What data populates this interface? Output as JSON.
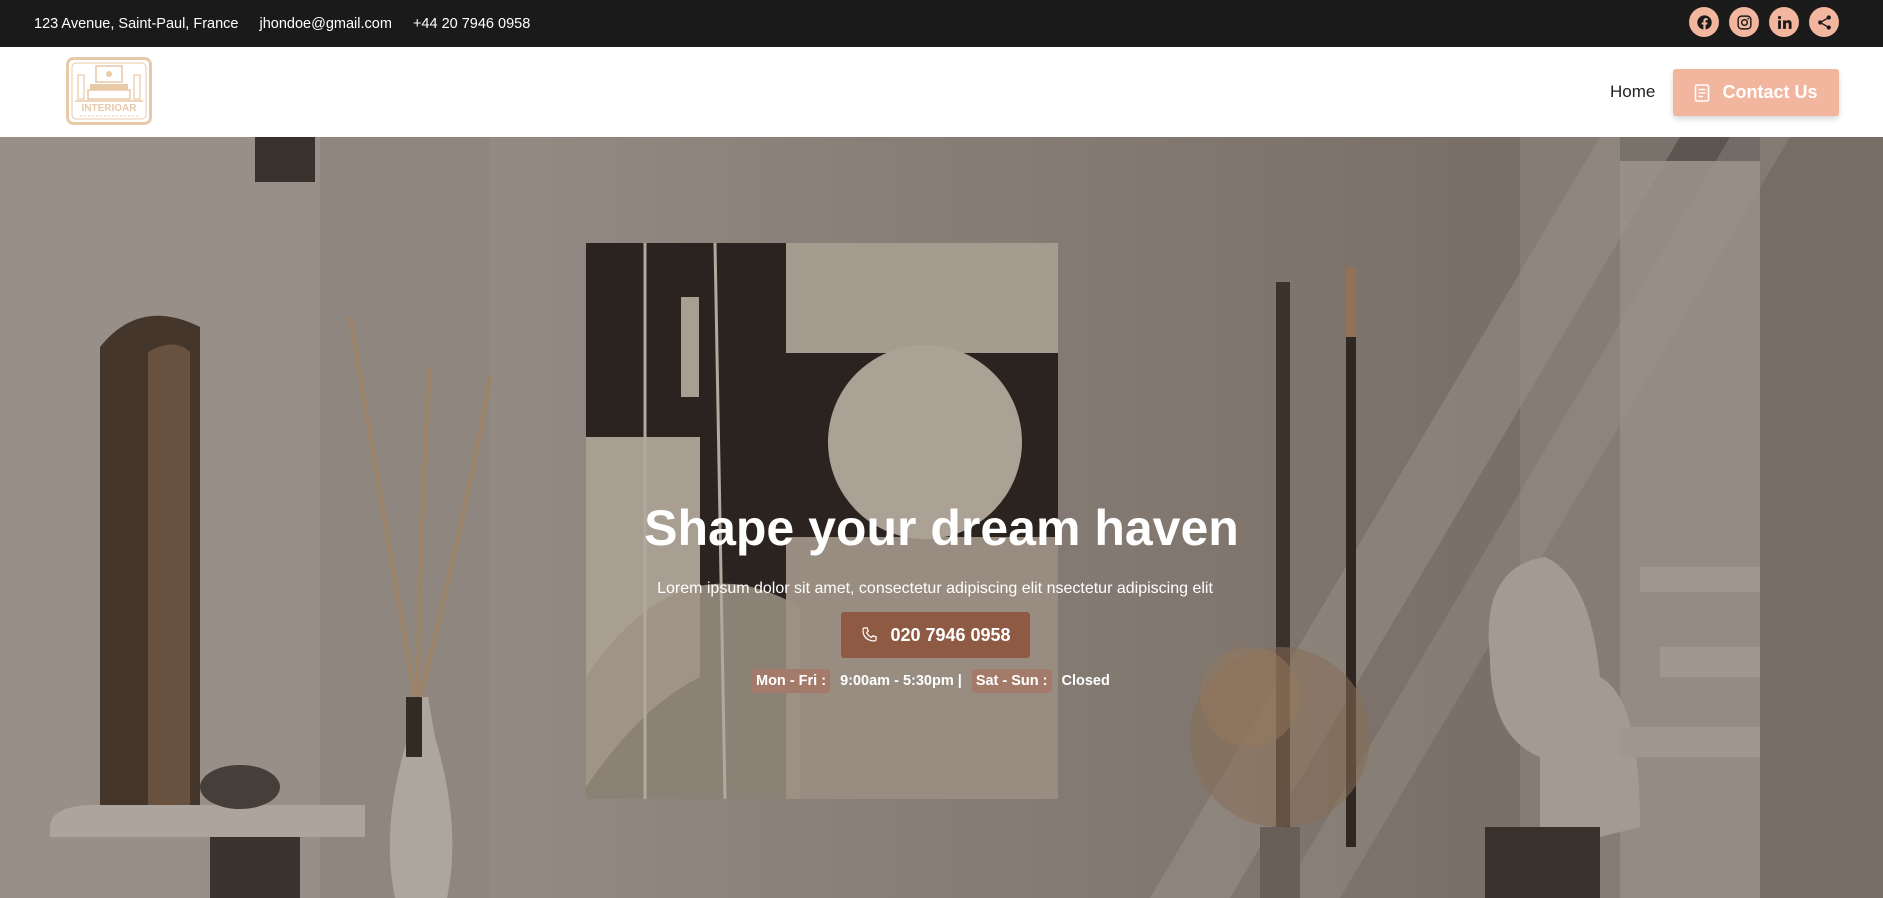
{
  "topbar": {
    "address": "123 Avenue, Saint-Paul, France",
    "email": "jhondoe@gmail.com",
    "phone": "+44 20 7946 0958",
    "socials": [
      "facebook-icon",
      "instagram-icon",
      "linkedin-icon",
      "share-icon"
    ]
  },
  "nav": {
    "logo_text": "INTERIOAR",
    "home_label": "Home",
    "contact_label": "Contact Us"
  },
  "hero": {
    "title": "Shape your dream haven",
    "subtitle": "Lorem ipsum dolor sit amet, consectetur adipiscing elit nsectetur adipiscing elit",
    "phone_label": "020 7946 0958",
    "weekday_label": "Mon - Fri :",
    "weekday_hours": "9:00am - 5:30pm |",
    "weekend_label": "Sat - Sun :",
    "weekend_hours": "Closed"
  },
  "colors": {
    "accent": "#f2b59e",
    "phone_button": "#8e5a43",
    "topbar": "#1a1a1a"
  }
}
